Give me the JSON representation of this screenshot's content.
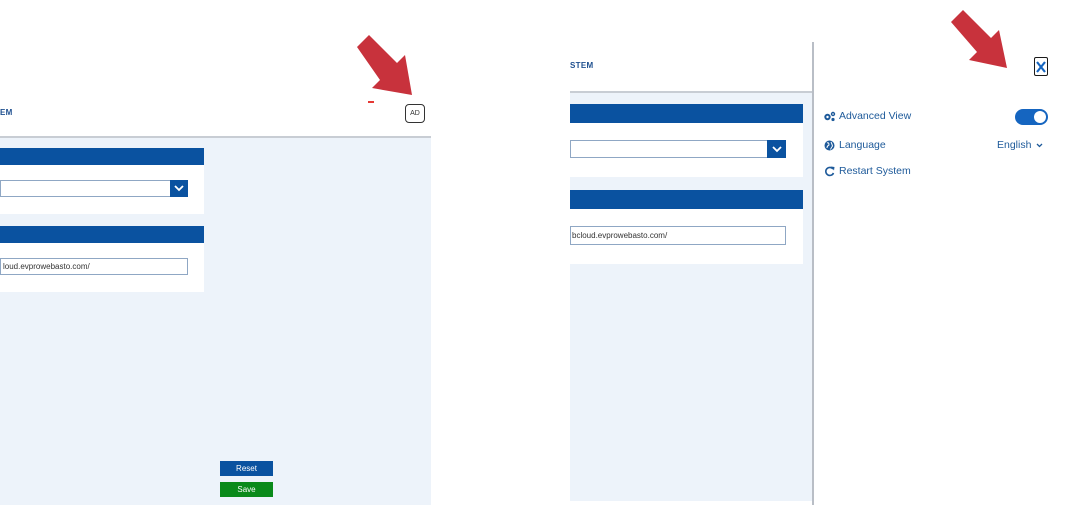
{
  "left_screen": {
    "title_fragment": "EM",
    "avatar_initials": "AD",
    "url_value": "loud.evprowebasto.com/",
    "reset_label": "Reset",
    "save_label": "Save"
  },
  "right_screen": {
    "title_fragment": "STEM",
    "url_value": "bcloud.evprowebasto.com/",
    "settings_menu": {
      "items": [
        {
          "label": "Advanced View",
          "icon": "gears-icon",
          "control": "toggle",
          "toggle_on": true
        },
        {
          "label": "Language",
          "icon": "globe-icon",
          "control": "select",
          "value": "English"
        },
        {
          "label": "Restart System",
          "icon": "restart-icon"
        }
      ],
      "close_icon": "close-icon"
    }
  },
  "annotations": {
    "arrow_color": "#c8323c"
  },
  "colors": {
    "brand_blue": "#0a52a0",
    "save_green": "#0a8a1a",
    "link_blue": "#1e5a9a",
    "panel_bg": "#edf3fa"
  }
}
